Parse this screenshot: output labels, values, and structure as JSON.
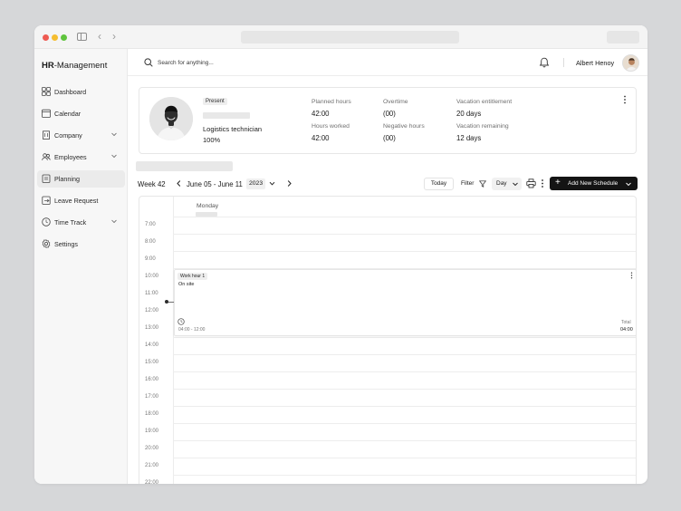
{
  "brand": {
    "bold": "HR",
    "rest": "-Management"
  },
  "sidebar": {
    "items": [
      {
        "label": "Dashboard",
        "icon": "grid-icon"
      },
      {
        "label": "Calendar",
        "icon": "calendar-icon"
      },
      {
        "label": "Company",
        "icon": "building-icon"
      },
      {
        "label": "Employees",
        "icon": "users-icon"
      },
      {
        "label": "Planning",
        "icon": "clipboard-icon",
        "active": true
      },
      {
        "label": "Leave Request",
        "icon": "leave-icon"
      },
      {
        "label": "Time Track",
        "icon": "clock-icon"
      },
      {
        "label": "Settings",
        "icon": "gear-icon"
      }
    ]
  },
  "header": {
    "search_placeholder": "Search for anything...",
    "user_name": "Albert Henoy"
  },
  "profile": {
    "status": "Present",
    "role": "Logistics technician",
    "percent": "100%",
    "stats": {
      "planned_label": "Planned hours",
      "planned_value": "42:00",
      "worked_label": "Hours worked",
      "worked_value": "42:00",
      "overtime_label": "Overtime",
      "overtime_value": "(00)",
      "negative_label": "Negative hours",
      "negative_value": "(00)",
      "vac_ent_label": "Vacation entitlement",
      "vac_ent_value": "20 days",
      "vac_rem_label": "Vacation remaining",
      "vac_rem_value": "12 days"
    }
  },
  "toolbar": {
    "week": "Week 42",
    "range": "June 05 - June 11",
    "year": "2023",
    "today": "Today",
    "filter": "Filter",
    "view": "Day",
    "add": "Add New Schedule"
  },
  "calendar": {
    "day": "Monday",
    "hours": [
      "7:00",
      "8:00",
      "9:00",
      "10:00",
      "11:00",
      "12:00",
      "13:00",
      "14:00",
      "15:00",
      "16:00",
      "17:00",
      "18:00",
      "19:00",
      "20:00",
      "21:00",
      "22:00"
    ],
    "event": {
      "tag": "Work hour 1",
      "subtitle": "On site",
      "time": "04:00 - 12:00",
      "total_label": "Total",
      "total_value": "04:00"
    }
  },
  "colors": {
    "accent": "#141414",
    "active_nav": "#ebebeb",
    "window_bg": "#ffffff",
    "desktop_bg": "#d6d7d9"
  }
}
